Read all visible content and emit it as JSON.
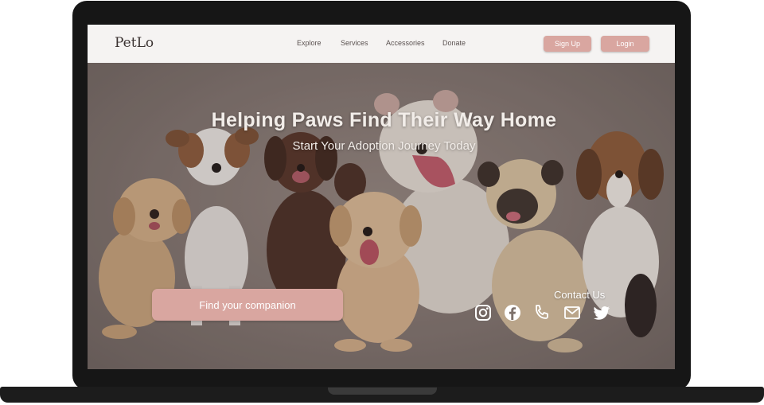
{
  "brand": {
    "logo": "PetLo"
  },
  "nav": {
    "links": [
      "Explore",
      "Services",
      "Accessories",
      "Donate"
    ],
    "signup_label": "Sign Up",
    "login_label": "Login"
  },
  "hero": {
    "headline": "Helping Paws Find Their Way Home",
    "subheadline": "Start Your Adoption Journey Today",
    "cta_label": "Find your companion"
  },
  "contact": {
    "label": "Contact Us",
    "icons": [
      "instagram-icon",
      "facebook-icon",
      "phone-icon",
      "mail-icon",
      "twitter-icon"
    ]
  },
  "colors": {
    "accent": "#d9a6a0",
    "navbar_bg": "#f5f3f2",
    "hero_bg": "#857873",
    "device_frame": "#161616"
  }
}
